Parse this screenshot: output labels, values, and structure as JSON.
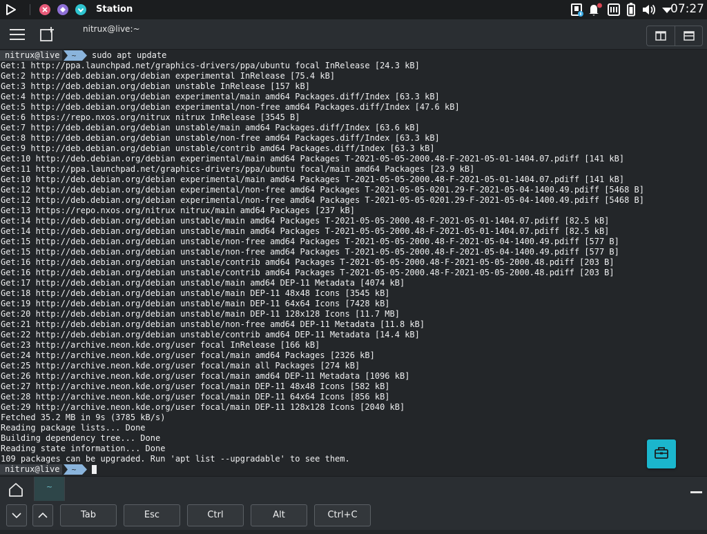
{
  "topbar": {
    "app_title": "Station",
    "clock": "07:27",
    "colors": {
      "close": "#e85a79",
      "minimize": "#8e6fd6",
      "maximize": "#2ec4cf"
    }
  },
  "header": {
    "host": "nitrux@live:~"
  },
  "prompt": {
    "user": "nitrux@live",
    "dir": "~",
    "command": "sudo apt update"
  },
  "output": [
    "Get:1 http://ppa.launchpad.net/graphics-drivers/ppa/ubuntu focal InRelease [24.3 kB]",
    "Get:2 http://deb.debian.org/debian experimental InRelease [75.4 kB]",
    "Get:3 http://deb.debian.org/debian unstable InRelease [157 kB]",
    "Get:4 http://deb.debian.org/debian experimental/main amd64 Packages.diff/Index [63.3 kB]",
    "Get:5 http://deb.debian.org/debian experimental/non-free amd64 Packages.diff/Index [47.6 kB]",
    "Get:6 https://repo.nxos.org/nitrux nitrux InRelease [3545 B]",
    "Get:7 http://deb.debian.org/debian unstable/main amd64 Packages.diff/Index [63.6 kB]",
    "Get:8 http://deb.debian.org/debian unstable/non-free amd64 Packages.diff/Index [63.3 kB]",
    "Get:9 http://deb.debian.org/debian unstable/contrib amd64 Packages.diff/Index [63.3 kB]",
    "Get:10 http://deb.debian.org/debian experimental/main amd64 Packages T-2021-05-05-2000.48-F-2021-05-01-1404.07.pdiff [141 kB]",
    "Get:11 http://ppa.launchpad.net/graphics-drivers/ppa/ubuntu focal/main amd64 Packages [23.9 kB]",
    "Get:10 http://deb.debian.org/debian experimental/main amd64 Packages T-2021-05-05-2000.48-F-2021-05-01-1404.07.pdiff [141 kB]",
    "Get:12 http://deb.debian.org/debian experimental/non-free amd64 Packages T-2021-05-05-0201.29-F-2021-05-04-1400.49.pdiff [5468 B]",
    "Get:12 http://deb.debian.org/debian experimental/non-free amd64 Packages T-2021-05-05-0201.29-F-2021-05-04-1400.49.pdiff [5468 B]",
    "Get:13 https://repo.nxos.org/nitrux nitrux/main amd64 Packages [237 kB]",
    "Get:14 http://deb.debian.org/debian unstable/main amd64 Packages T-2021-05-05-2000.48-F-2021-05-01-1404.07.pdiff [82.5 kB]",
    "Get:14 http://deb.debian.org/debian unstable/main amd64 Packages T-2021-05-05-2000.48-F-2021-05-01-1404.07.pdiff [82.5 kB]",
    "Get:15 http://deb.debian.org/debian unstable/non-free amd64 Packages T-2021-05-05-2000.48-F-2021-05-04-1400.49.pdiff [577 B]",
    "Get:15 http://deb.debian.org/debian unstable/non-free amd64 Packages T-2021-05-05-2000.48-F-2021-05-04-1400.49.pdiff [577 B]",
    "Get:16 http://deb.debian.org/debian unstable/contrib amd64 Packages T-2021-05-05-2000.48-F-2021-05-05-2000.48.pdiff [203 B]",
    "Get:16 http://deb.debian.org/debian unstable/contrib amd64 Packages T-2021-05-05-2000.48-F-2021-05-05-2000.48.pdiff [203 B]",
    "Get:17 http://deb.debian.org/debian unstable/main amd64 DEP-11 Metadata [4074 kB]",
    "Get:18 http://deb.debian.org/debian unstable/main DEP-11 48x48 Icons [3545 kB]",
    "Get:19 http://deb.debian.org/debian unstable/main DEP-11 64x64 Icons [7428 kB]",
    "Get:20 http://deb.debian.org/debian unstable/main DEP-11 128x128 Icons [11.7 MB]",
    "Get:21 http://deb.debian.org/debian unstable/non-free amd64 DEP-11 Metadata [11.8 kB]",
    "Get:22 http://deb.debian.org/debian unstable/contrib amd64 DEP-11 Metadata [14.4 kB]",
    "Get:23 http://archive.neon.kde.org/user focal InRelease [166 kB]",
    "Get:24 http://archive.neon.kde.org/user focal/main amd64 Packages [2326 kB]",
    "Get:25 http://archive.neon.kde.org/user focal/main all Packages [274 kB]",
    "Get:26 http://archive.neon.kde.org/user focal/main amd64 DEP-11 Metadata [1096 kB]",
    "Get:27 http://archive.neon.kde.org/user focal/main DEP-11 48x48 Icons [582 kB]",
    "Get:28 http://archive.neon.kde.org/user focal/main DEP-11 64x64 Icons [856 kB]",
    "Get:29 http://archive.neon.kde.org/user focal/main DEP-11 128x128 Icons [2040 kB]",
    "Fetched 35.2 MB in 9s (3785 kB/s)",
    "Reading package lists... Done",
    "Building dependency tree... Done",
    "Reading state information... Done",
    "109 packages can be upgraded. Run 'apt list --upgradable' to see them."
  ],
  "tabs": [
    {
      "label": "~"
    }
  ],
  "keys": {
    "tab": "Tab",
    "esc": "Esc",
    "ctrl": "Ctrl",
    "alt": "Alt",
    "ctrl_c": "Ctrl+C"
  },
  "icons": [
    "launcher-icon",
    "close-icon",
    "minimize-icon",
    "maximize-icon",
    "kde-connect-icon",
    "notifications-icon",
    "network-icon",
    "battery-icon",
    "volume-icon",
    "wifi-icon",
    "menu-icon",
    "new-tab-icon",
    "split-horizontal-icon",
    "split-vertical-icon",
    "toolbox-icon",
    "home-icon",
    "chevron-down-icon",
    "chevron-up-icon"
  ]
}
